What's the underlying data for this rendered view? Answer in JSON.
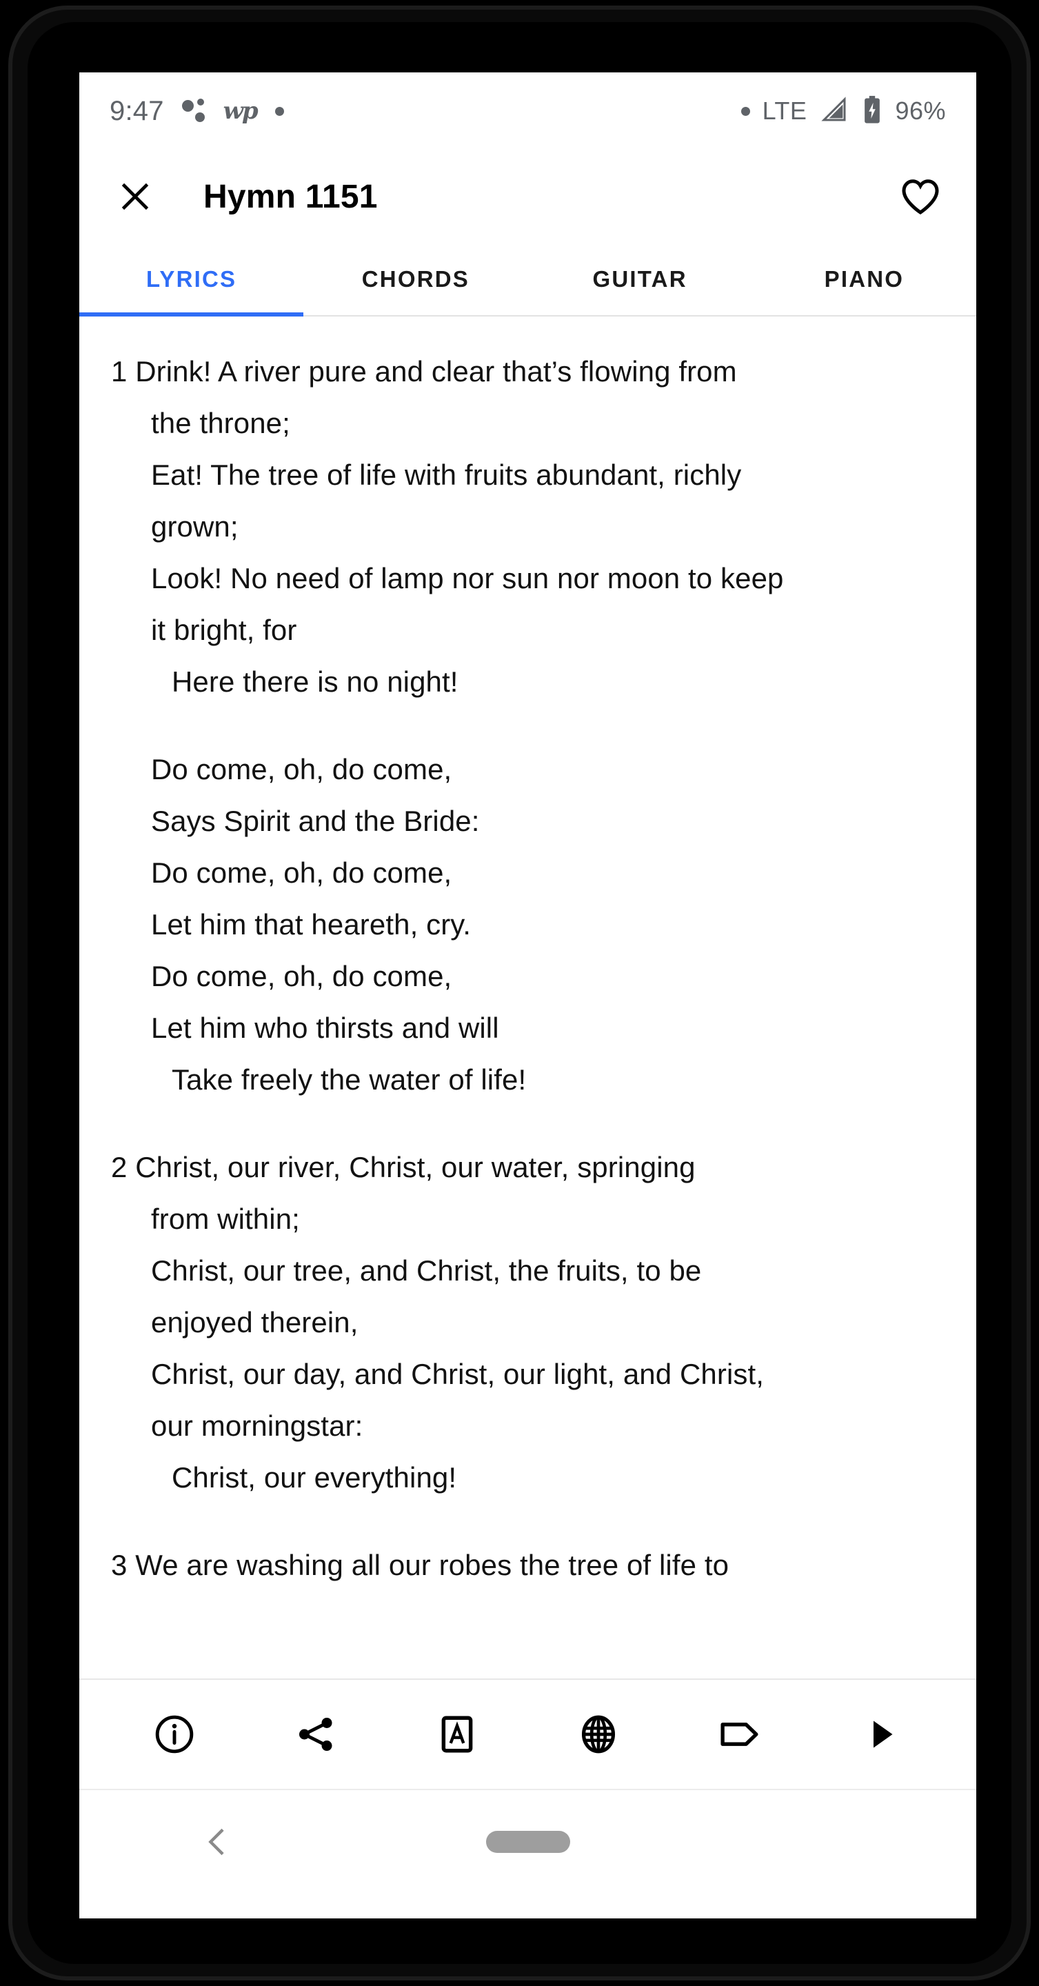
{
  "status_bar": {
    "time": "9:47",
    "notification_icons": [
      "dots-icon",
      "washington-post-icon",
      "dot-icon"
    ],
    "wp_logo_text": "wp",
    "network_type": "LTE",
    "battery_percent": "96%",
    "icon_color": "#5f6368"
  },
  "app_bar": {
    "close_icon": "close-icon",
    "title": "Hymn 1151",
    "favorite_icon": "heart-icon"
  },
  "tabs": {
    "active_index": 0,
    "accent_color": "#2f6df6",
    "items": [
      {
        "label": "LYRICS"
      },
      {
        "label": "CHORDS"
      },
      {
        "label": "GUITAR"
      },
      {
        "label": "PIANO"
      }
    ]
  },
  "lyrics": {
    "blocks": [
      {
        "type": "verse",
        "number": "1",
        "lines": [
          {
            "text": "1 Drink! A river pure and clear that’s flowing from",
            "style": "first"
          },
          {
            "text": "the throne;",
            "style": "cont"
          },
          {
            "text": "Eat! The tree of life with fruits abundant, richly",
            "style": "cont"
          },
          {
            "text": "grown;",
            "style": "cont"
          },
          {
            "text": "Look! No need of lamp nor sun nor moon to keep",
            "style": "cont"
          },
          {
            "text": "it bright, for",
            "style": "cont"
          },
          {
            "text": "Here there is no night!",
            "style": "indent"
          }
        ]
      },
      {
        "type": "chorus",
        "number": "",
        "lines": [
          {
            "text": "Do come, oh, do come,",
            "style": "cont"
          },
          {
            "text": "Says Spirit and the Bride:",
            "style": "cont"
          },
          {
            "text": "Do come, oh, do come,",
            "style": "cont"
          },
          {
            "text": "Let him that heareth, cry.",
            "style": "cont"
          },
          {
            "text": "Do come, oh, do come,",
            "style": "cont"
          },
          {
            "text": "Let him who thirsts and will",
            "style": "cont"
          },
          {
            "text": "Take freely the water of life!",
            "style": "indent"
          }
        ]
      },
      {
        "type": "verse",
        "number": "2",
        "lines": [
          {
            "text": "2 Christ, our river, Christ, our water, springing",
            "style": "first"
          },
          {
            "text": "from within;",
            "style": "cont"
          },
          {
            "text": "Christ, our tree, and Christ, the fruits, to be",
            "style": "cont"
          },
          {
            "text": "enjoyed therein,",
            "style": "cont"
          },
          {
            "text": "Christ, our day, and Christ, our light, and Christ,",
            "style": "cont"
          },
          {
            "text": "our morningstar:",
            "style": "cont"
          },
          {
            "text": "Christ, our everything!",
            "style": "indent"
          }
        ]
      },
      {
        "type": "verse",
        "number": "3",
        "lines": [
          {
            "text": "3 We are washing all our robes the tree of life to",
            "style": "first"
          }
        ]
      }
    ]
  },
  "bottom_toolbar": {
    "buttons": [
      {
        "icon": "info-icon",
        "name": "info-button"
      },
      {
        "icon": "share-icon",
        "name": "share-button"
      },
      {
        "icon": "font-size-icon",
        "name": "text-settings-button"
      },
      {
        "icon": "globe-icon",
        "name": "language-button"
      },
      {
        "icon": "tag-icon",
        "name": "tag-button"
      },
      {
        "icon": "play-icon",
        "name": "play-button"
      }
    ]
  },
  "nav_bar": {
    "back_icon": "chevron-left-icon",
    "home_icon": "home-pill-icon",
    "color": "#9e9e9e"
  }
}
